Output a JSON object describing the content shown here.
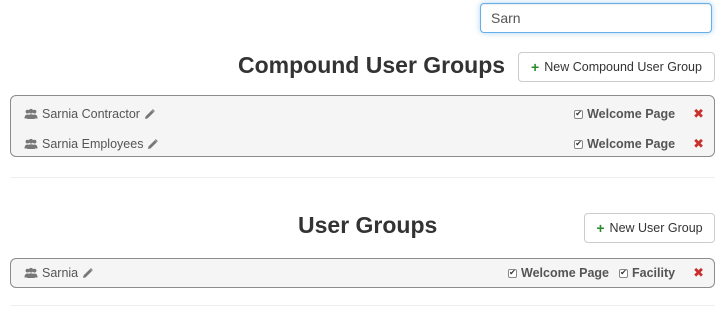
{
  "search": {
    "value": "Sarn",
    "placeholder": ""
  },
  "compound": {
    "title": "Compound User Groups",
    "new_button": "New Compound User Group",
    "rows": [
      {
        "name": "Sarnia Contractor",
        "permissions": [
          "Welcome Page"
        ]
      },
      {
        "name": "Sarnia Employees",
        "permissions": [
          "Welcome Page"
        ]
      }
    ]
  },
  "user_groups": {
    "title": "User Groups",
    "new_button": "New User Group",
    "rows": [
      {
        "name": "Sarnia",
        "permissions": [
          "Welcome Page",
          "Facility"
        ]
      }
    ]
  },
  "symbols": {
    "plus": "+",
    "delete": "✖",
    "check": "✔"
  },
  "colors": {
    "accent_green": "#2a8a2a",
    "delete_red": "#c9302c",
    "focus_blue": "#66afe9"
  }
}
